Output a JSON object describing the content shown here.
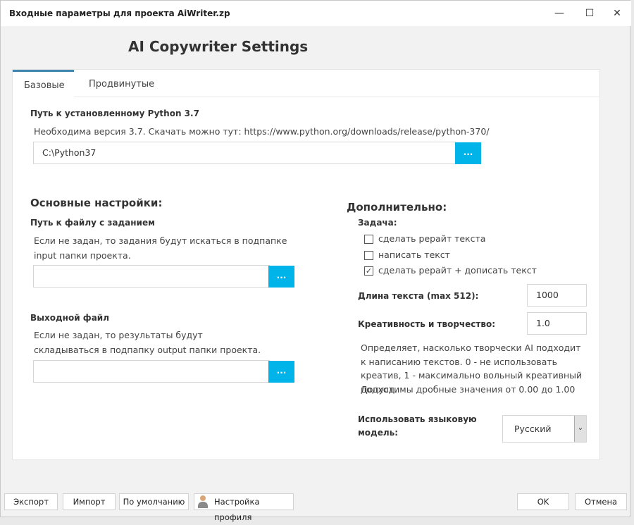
{
  "window": {
    "title": "Входные параметры для проекта AiWriter.zp",
    "minimize": "—",
    "maximize": "☐",
    "close": "✕"
  },
  "heading": "AI Copywriter Settings",
  "tabs": [
    {
      "label": "Базовые",
      "active": true
    },
    {
      "label": "Продвинутые",
      "active": false
    }
  ],
  "python": {
    "label": "Путь к установленному Python 3.7",
    "hint": "Необходима версия 3.7. Скачать можно тут: https://www.python.org/downloads/release/python-370/",
    "value": "C:\\Python37",
    "browse": "..."
  },
  "main": {
    "title": "Основные настройки:",
    "task_file": {
      "label": "Путь к файлу с заданием",
      "hint": "Если не задан, то задания будут искаться в подпапке input папки проекта.",
      "value": "",
      "browse": "..."
    },
    "output_file": {
      "label": "Выходной файл",
      "hint": "Если не задан, то результаты будут складываться в подпапку output папки проекта.",
      "value": "",
      "browse": "..."
    }
  },
  "extra": {
    "title": "Дополнительно:",
    "task_label": "Задача:",
    "options": [
      {
        "label": "сделать рерайт текста",
        "checked": false
      },
      {
        "label": "написать текст",
        "checked": false
      },
      {
        "label": "сделать рерайт + дописать текст",
        "checked": true
      }
    ],
    "length_label": "Длина текста (max 512):",
    "length_value": "1000",
    "creativity_label": "Креативность и творчество:",
    "creativity_value": "1.0",
    "creativity_hint": "Определяет, насколько творчески AI подходит к написанию текстов. 0 - не использовать креатив, 1 - максимально вольный креативный подход.",
    "creativity_range": "Допустимы дробные значения от 0.00 до 1.00",
    "model_label": "Использовать языковую модель:",
    "model_value": "Русский"
  },
  "footer": {
    "export": "Экспорт",
    "import": "Импорт",
    "default": "По умолчанию",
    "profile": "Настройка профиля",
    "ok": "OK",
    "cancel": "Отмена"
  },
  "colors": {
    "accent": "#00b3e8",
    "tab_accent": "#3f87b0"
  }
}
